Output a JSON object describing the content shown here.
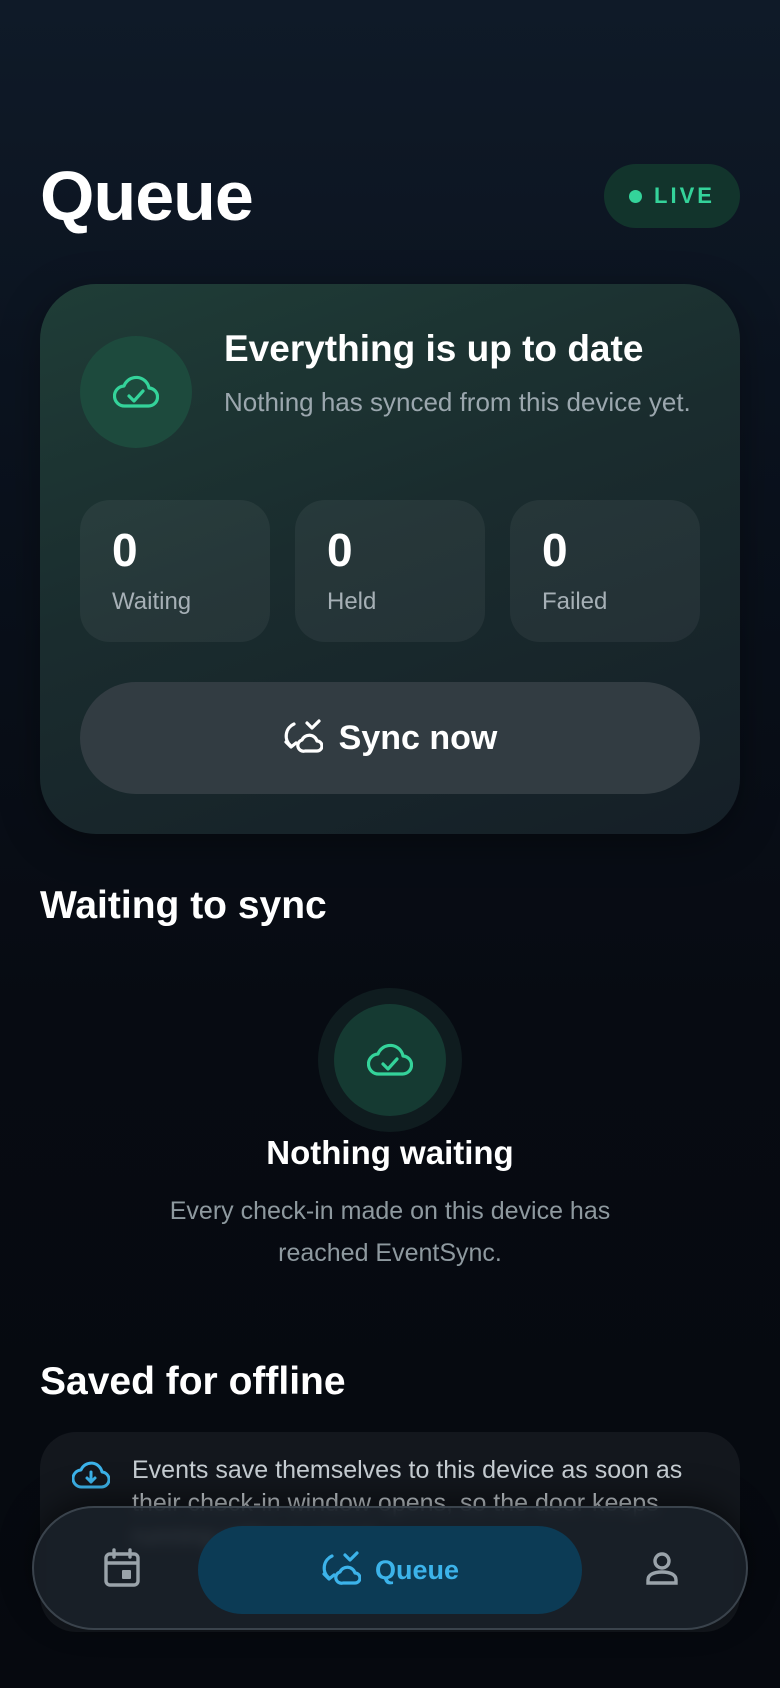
{
  "header": {
    "title": "Queue",
    "live_badge": "LIVE"
  },
  "status_card": {
    "icon": "cloud-check-icon",
    "title": "Everything is up to date",
    "subtitle": "Nothing has synced from this device yet.",
    "stats": [
      {
        "value": "0",
        "label": "Waiting"
      },
      {
        "value": "0",
        "label": "Held"
      },
      {
        "value": "0",
        "label": "Failed"
      }
    ],
    "sync_button": {
      "icon": "sync-icon",
      "label": "Sync now"
    }
  },
  "waiting_section": {
    "title": "Waiting to sync",
    "empty_icon": "cloud-check-icon",
    "empty_title": "Nothing waiting",
    "empty_description": "Every check-in made on this device has reached EventSync."
  },
  "offline_section": {
    "title": "Saved for offline",
    "icon": "cloud-download-icon",
    "text": "Events save themselves to this device as soon as their check-in window opens, so the door keeps running without signal."
  },
  "tabbar": {
    "events_icon": "calendar-icon",
    "queue": {
      "icon": "sync-icon",
      "label": "Queue"
    },
    "profile_icon": "person-icon"
  },
  "colors": {
    "accent_green": "#34d39a",
    "accent_blue": "#3cb3ea",
    "background": "#070b12"
  }
}
